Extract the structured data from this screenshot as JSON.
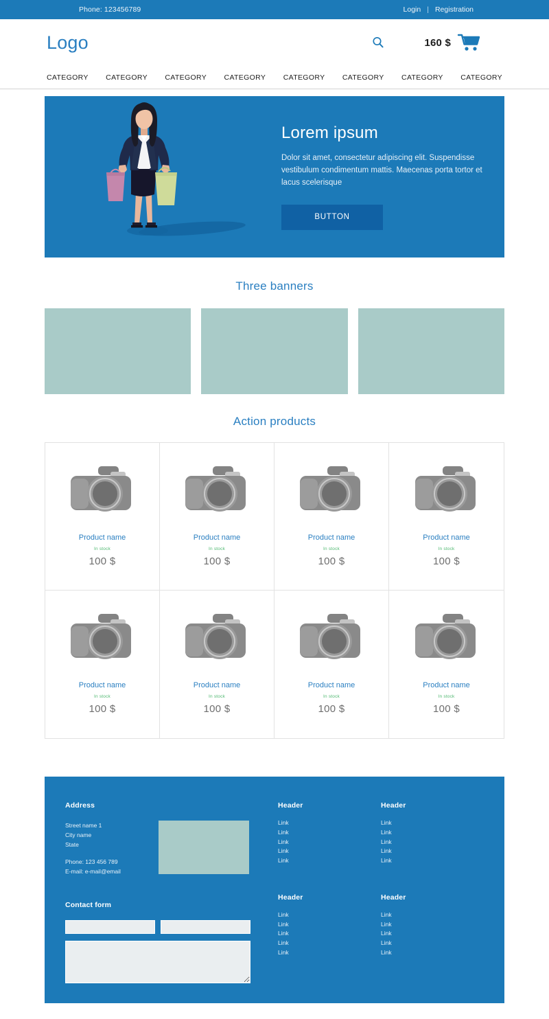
{
  "topbar": {
    "phone": "Phone: 123456789",
    "login": "Login",
    "separator": "|",
    "registration": "Registration"
  },
  "header": {
    "logo": "Logo",
    "search_icon": "search-icon",
    "cart_total": "160 $",
    "cart_icon": "shopping-cart-icon"
  },
  "nav": {
    "items": [
      {
        "label": "CATEGORY"
      },
      {
        "label": "CATEGORY"
      },
      {
        "label": "CATEGORY"
      },
      {
        "label": "CATEGORY"
      },
      {
        "label": "CATEGORY"
      },
      {
        "label": "CATEGORY"
      },
      {
        "label": "CATEGORY"
      },
      {
        "label": "CATEGORY"
      }
    ]
  },
  "hero": {
    "title": "Lorem ipsum",
    "text": "Dolor sit amet, consectetur adipiscing elit. Suspendisse vestibulum condimentum mattis. Maecenas porta tortor et lacus scelerisque",
    "button": "BUTTON",
    "illustration": "woman-with-shopping-bags-illustration"
  },
  "banners": {
    "title": "Three banners",
    "items": [
      {
        "name": "banner-1"
      },
      {
        "name": "banner-2"
      },
      {
        "name": "banner-3"
      }
    ]
  },
  "products": {
    "title": "Action products",
    "items": [
      {
        "name": "Product name",
        "stock": "In stock",
        "price": "100 $",
        "image": "camera-icon"
      },
      {
        "name": "Product name",
        "stock": "In stock",
        "price": "100 $",
        "image": "camera-icon"
      },
      {
        "name": "Product name",
        "stock": "In stock",
        "price": "100 $",
        "image": "camera-icon"
      },
      {
        "name": "Product name",
        "stock": "In stock",
        "price": "100 $",
        "image": "camera-icon"
      },
      {
        "name": "Product name",
        "stock": "In stock",
        "price": "100 $",
        "image": "camera-icon"
      },
      {
        "name": "Product name",
        "stock": "In stock",
        "price": "100 $",
        "image": "camera-icon"
      },
      {
        "name": "Product name",
        "stock": "In stock",
        "price": "100 $",
        "image": "camera-icon"
      },
      {
        "name": "Product name",
        "stock": "In stock",
        "price": "100 $",
        "image": "camera-icon"
      }
    ]
  },
  "footer": {
    "address": {
      "heading": "Address",
      "street": "Street name 1",
      "city": "City name",
      "state": "State",
      "phone": "Phone: 123 456 789",
      "email": "E-mail: e-mail@email",
      "map": "map-placeholder"
    },
    "contact_form": {
      "heading": "Contact form",
      "field_1_value": "",
      "field_2_value": "",
      "message_value": ""
    },
    "columns": [
      {
        "heading": "Header",
        "links": [
          "Link",
          "Link",
          "Link",
          "Link",
          "Link"
        ]
      },
      {
        "heading": "Header",
        "links": [
          "Link",
          "Link",
          "Link",
          "Link",
          "Link"
        ]
      },
      {
        "heading": "Header",
        "links": [
          "Link",
          "Link",
          "Link",
          "Link",
          "Link"
        ]
      },
      {
        "heading": "Header",
        "links": [
          "Link",
          "Link",
          "Link",
          "Link",
          "Link"
        ]
      }
    ]
  },
  "colors": {
    "brand_blue": "#1c7ab8",
    "button_blue": "#1061a4",
    "link_blue": "#2a7fc1",
    "banner_teal": "#a9cbc8",
    "stock_green": "#4fb870",
    "price_gray": "#6e6e6e"
  }
}
